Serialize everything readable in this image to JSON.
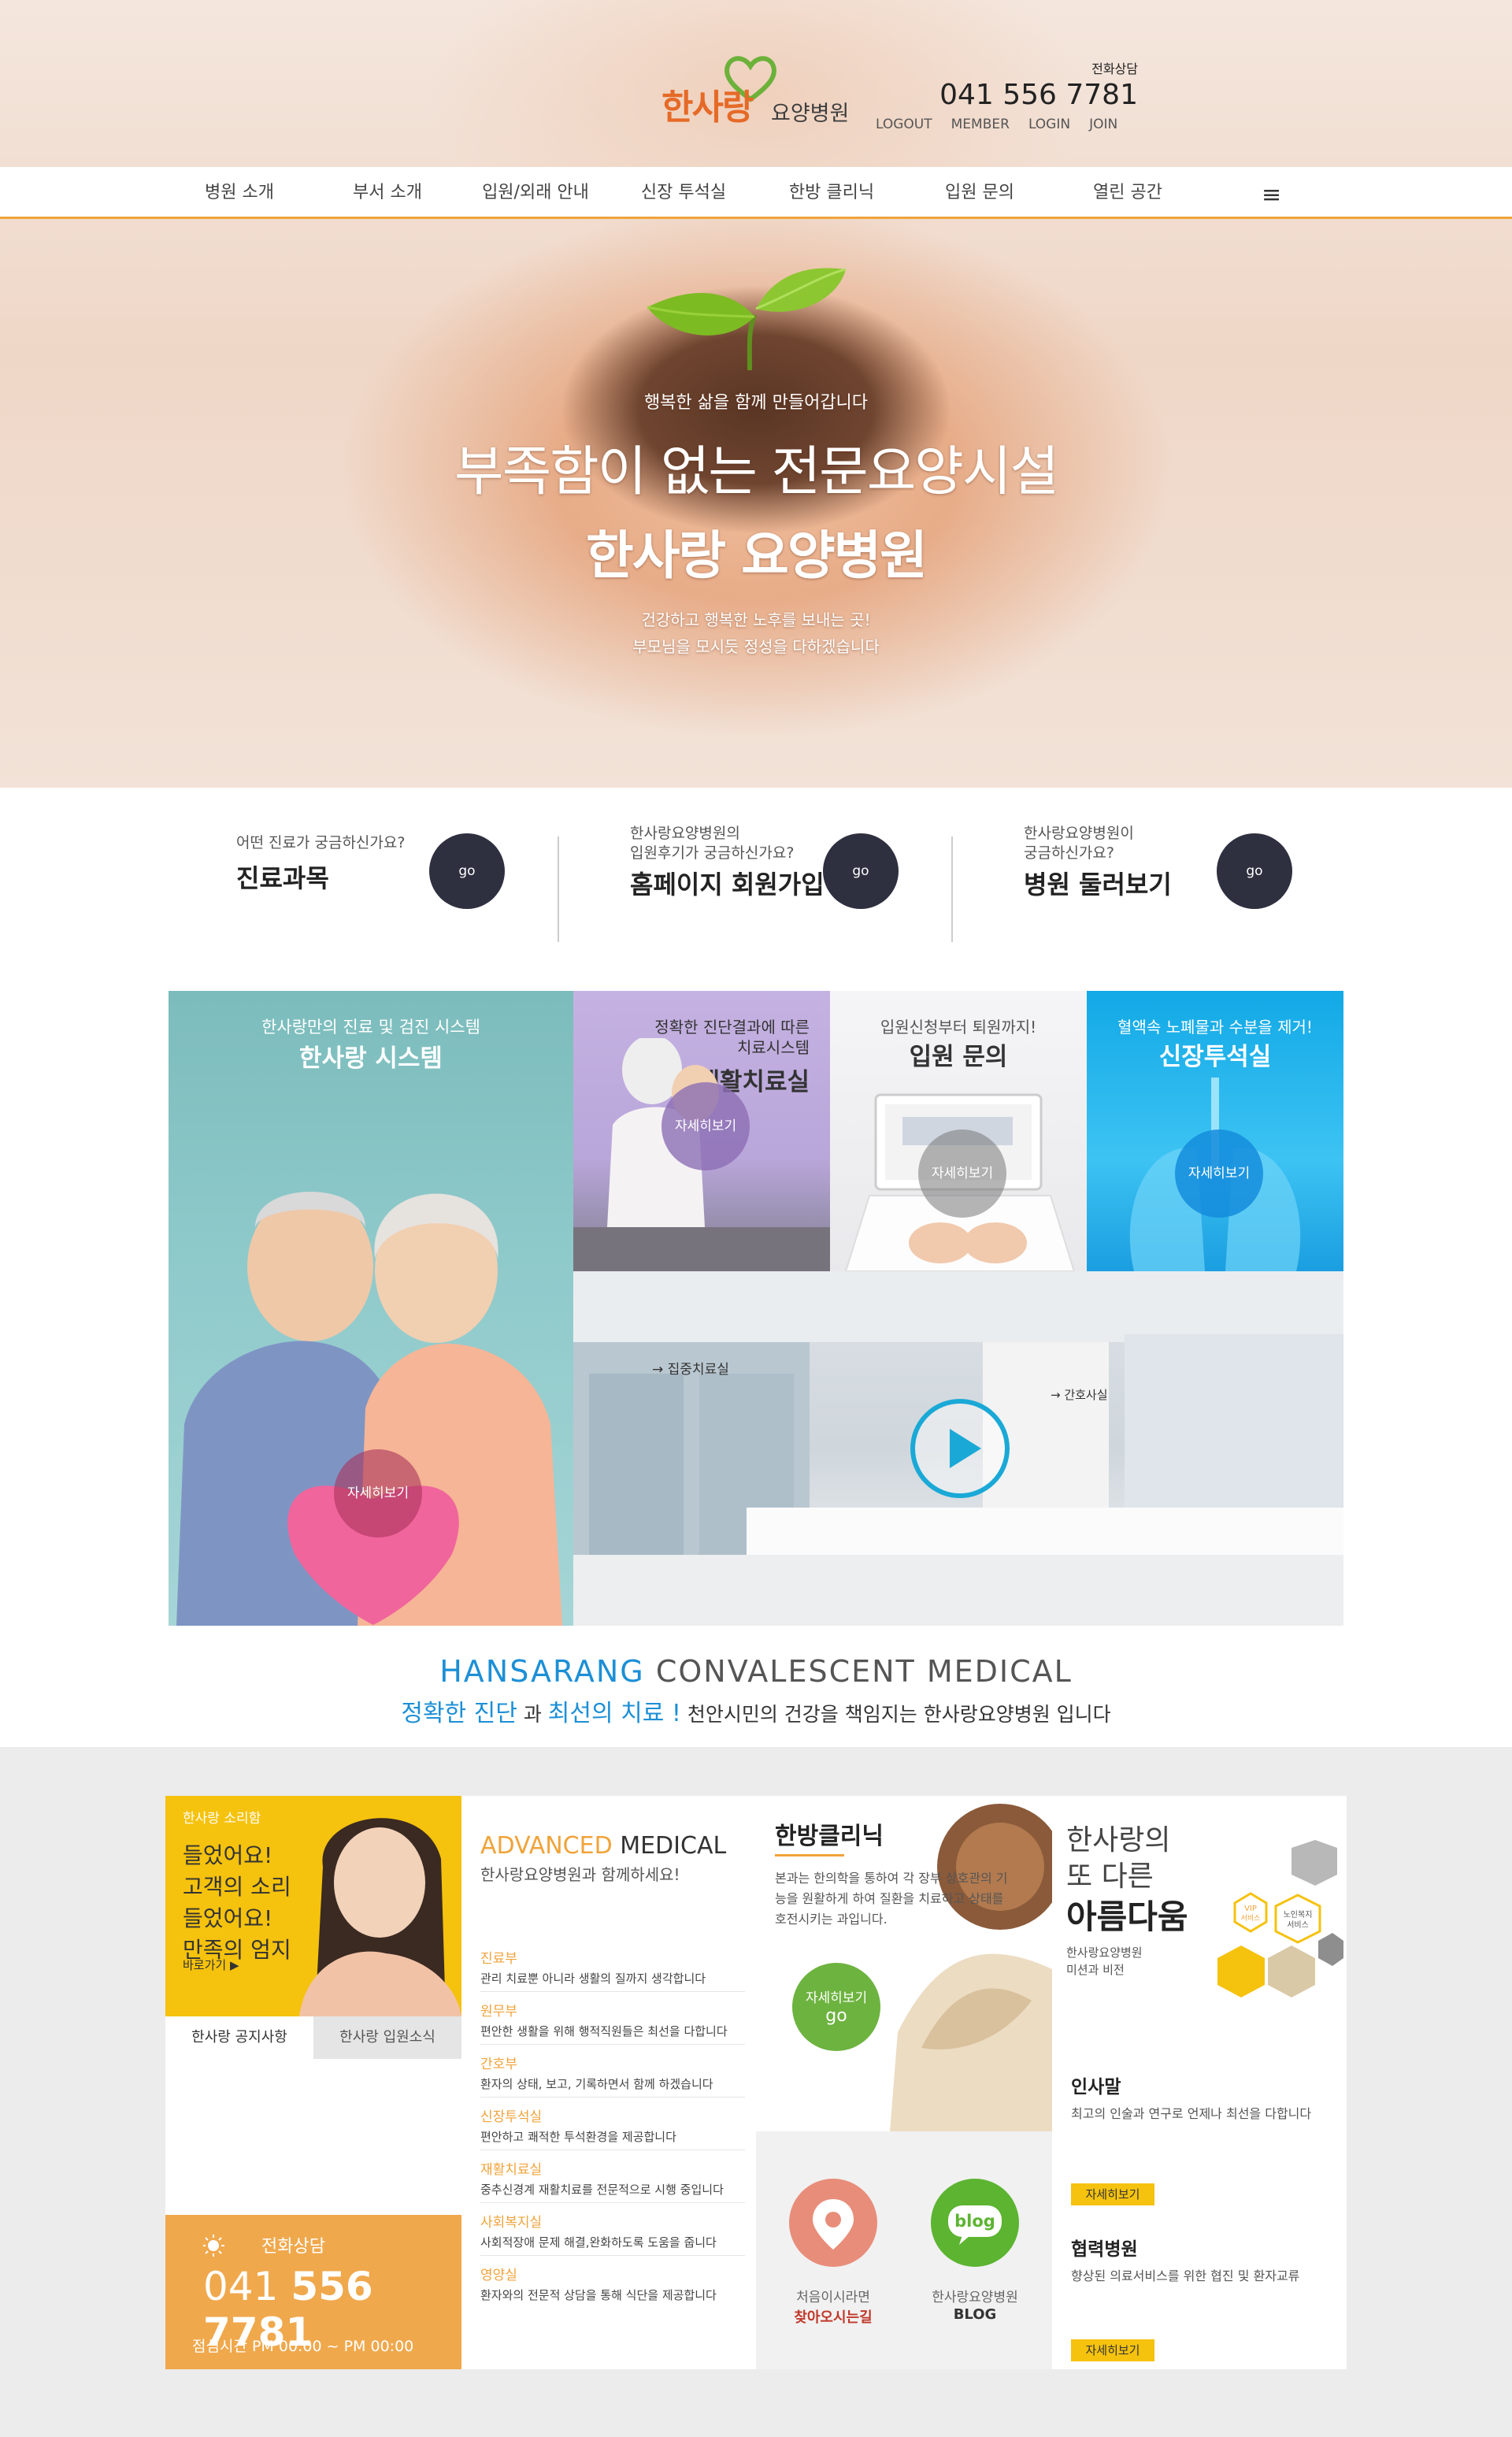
{
  "header": {
    "logo_text": "한사랑",
    "logo_sub": "요양병원",
    "phone_label": "전화상담",
    "phone_number": "041 556 7781",
    "top_links": [
      "LOGOUT",
      "MEMBER",
      "LOGIN",
      "JOIN"
    ]
  },
  "nav": {
    "items": [
      "병원 소개",
      "부서 소개",
      "입원/외래 안내",
      "신장 투석실",
      "한방 클리닉",
      "입원 문의",
      "열린 공간"
    ],
    "menu_icon": "≡"
  },
  "hero": {
    "small": "행복한 삶을 함께 만들어갑니다",
    "line1": "부족함이 없는 전문요양시설",
    "line2": "한사랑 요양병원",
    "desc1": "건강하고 행복한 노후를 보내는 곳!",
    "desc2": "부모님을 모시듯 정성을 다하겠습니다"
  },
  "quick": [
    {
      "label": "어떤 진료가 궁금하신가요?",
      "title": "진료과목",
      "go": "go"
    },
    {
      "label": "한사랑요양병원의\n입원후기가 궁금하신가요?",
      "title": "홈페이지 회원가입",
      "go": "go"
    },
    {
      "label": "한사랑요양병원이\n궁금하신가요?",
      "title": "병원 둘러보기",
      "go": "go"
    }
  ],
  "tiles": {
    "system": {
      "sub": "한사랑만의 진료 및 검진 시스템",
      "title": "한사랑 시스템",
      "more": "자세히보기"
    },
    "rehab": {
      "sub1": "정확한 진단결과에 따른",
      "sub2": "치료시스템",
      "title": "재활치료실",
      "more": "자세히보기"
    },
    "admit": {
      "sub": "입원신청부터 퇴원까지!",
      "title": "입원 문의",
      "more": "자세히보기"
    },
    "dialysis": {
      "sub": "혈액속 노폐물과 수분을 제거!",
      "title": "신장투석실",
      "more": "자세히보기"
    },
    "video": {
      "sign1": "→ 집중치료실",
      "sign2": "→ 간호사실"
    }
  },
  "slogan": {
    "en1": "HANSARANG",
    "en2": "CONVALESCENT MEDICAL",
    "kr_b1": "정확한 진단",
    "kr_t1": " 과 ",
    "kr_b2": "최선의 치료 !",
    "kr_t2": " 천안시민의 건강을 책임지는 한사랑요양병원 입니다"
  },
  "voice": {
    "label": "한사랑 소리함",
    "line1": "들었어요!",
    "line2": "고객의 소리",
    "line3": "들었어요!",
    "line4": "만족의 엄지",
    "more": "바로가기 ▶"
  },
  "notice_tabs": [
    "한사랑 공지사항",
    "한사랑 입원소식"
  ],
  "call": {
    "label": "전화상담",
    "number_a": "041 ",
    "number_b": "556 7781",
    "hours": "점심시간 PM 00:00 ~ PM 00:00"
  },
  "advanced": {
    "title_a": "ADVANCED",
    "title_b": " MEDICAL",
    "sub": "한사랑요양병원과 함께하세요!",
    "departments": [
      {
        "name": "진료부",
        "desc": "관리 치료뿐 아니라 생활의 질까지 생각합니다"
      },
      {
        "name": "원무부",
        "desc": "편안한 생활을 위해 행적직원들은 최선을 다합니다"
      },
      {
        "name": "간호부",
        "desc": "환자의 상태, 보고, 기록하면서 함께 하겠습니다"
      },
      {
        "name": "신장투석실",
        "desc": "편안하고 쾌적한 투석환경을 제공합니다"
      },
      {
        "name": "재활치료실",
        "desc": "중추신경계 재활치료를 전문적으로 시행 중입니다"
      },
      {
        "name": "사회복지실",
        "desc": "사회적장애 문제 해결,완화하도록 도움을 줍니다"
      },
      {
        "name": "영양실",
        "desc": "환자와의 전문적 상담을 통해 식단을 제공합니다"
      }
    ]
  },
  "herbal": {
    "title": "한방클리닉",
    "desc": "본과는 한의학을 통하여 각 장부 상호관의 기능을 원활하게 하여 질환을 치료하고 상태를 호전시키는 과입니다.",
    "more1": "자세히보기",
    "more2": "go",
    "map_label1": "처음이시라면",
    "map_label2": "찾아오시는길",
    "blog_label1": "한사랑요양병원",
    "blog_label2": "BLOG",
    "blog_icon_text": "blog"
  },
  "beauty": {
    "line1": "한사랑의",
    "line2": "또 다른",
    "line3": "아름다움",
    "sub1": "한사랑요양병원",
    "sub2": "미션과 비전",
    "badge1": "VIP 서비스",
    "badge2": "노인복지 서비스",
    "greet_title": "인사말",
    "greet_desc": "최고의 인술과 연구로 언제나 최선을 다합니다",
    "greet_more": "자세히보기",
    "coop_title": "협력병원",
    "coop_desc": "향상된 의료서비스를 위한 협진 및 환자교류",
    "coop_more": "자세히보기"
  },
  "colors": {
    "accent_orange": "#f0a33a",
    "logo_orange": "#e56a27",
    "slogan_blue": "#1c8fd6",
    "dark_button": "#2e3040",
    "yellow": "#f5c20e",
    "dialysis_blue": "#12a9e6",
    "green": "#6db33f"
  }
}
